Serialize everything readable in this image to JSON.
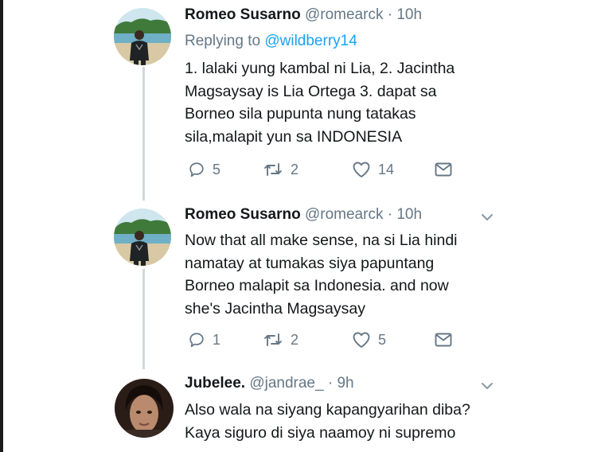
{
  "tweets": [
    {
      "name": "Romeo Susarno",
      "handle": "@romearck",
      "separator": "·",
      "time": "10h",
      "reply_label": "Replying to",
      "reply_mention": "@wildberry14",
      "lines": [
        "1. lalaki yung kambal ni Lia, 2. Jacintha",
        "Magsaysay is Lia Ortega 3. dapat sa",
        "Borneo sila pupunta nung tatakas",
        "sila,malapit yun sa INDONESIA"
      ],
      "replies": "5",
      "retweets": "2",
      "likes": "14"
    },
    {
      "name": "Romeo Susarno",
      "handle": "@romearck",
      "separator": "·",
      "time": "10h",
      "lines": [
        "Now that all make sense, na si Lia hindi",
        "namatay at tumakas siya papuntang",
        "Borneo malapit sa Indonesia. and now",
        "she's  Jacintha Magsaysay"
      ],
      "replies": "1",
      "retweets": "2",
      "likes": "5"
    },
    {
      "name": "Jubelee.",
      "handle": "@jandrae_",
      "separator": "·",
      "time": "9h",
      "lines": [
        "Also wala na siyang kapangyarihan diba?",
        "Kaya siguro di siya naamoy ni supremo"
      ]
    }
  ],
  "icons": {
    "reply": "reply-bubble-icon",
    "retweet": "retweet-arrows-icon",
    "like": "heart-icon",
    "dm": "envelope-icon",
    "menu": "chevron-down-icon"
  },
  "colors": {
    "name": "#14171a",
    "secondary": "#657786",
    "mention": "#1da1f2",
    "thread_line": "#cfd9de"
  }
}
